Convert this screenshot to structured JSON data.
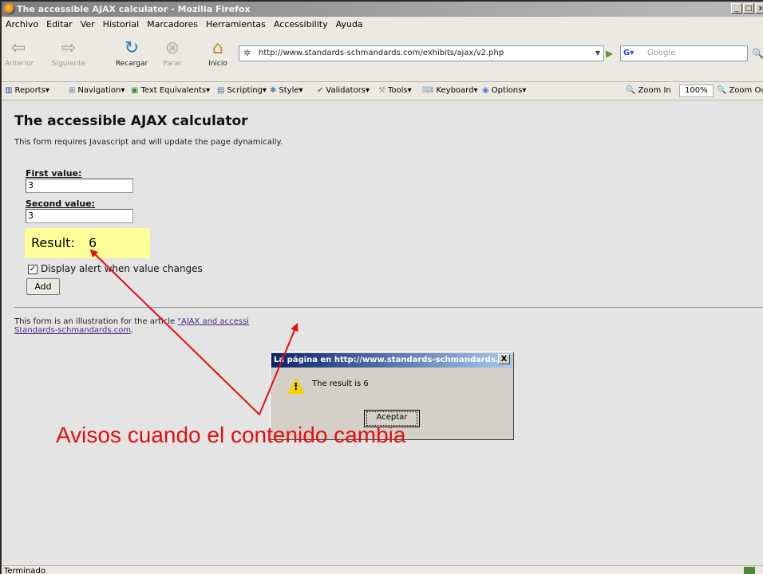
{
  "window": {
    "title": "The accessible AJAX calculator - Mozilla Firefox",
    "buttons": [
      "_",
      "□",
      "x"
    ]
  },
  "menu": [
    "Archivo",
    "Editar",
    "Ver",
    "Historial",
    "Marcadores",
    "Herramientas",
    "Accessibility",
    "Ayuda"
  ],
  "nav": {
    "back": "Anterior",
    "forward": "Siguiente",
    "reload": "Recargar",
    "stop": "Parar",
    "home": "Inicio",
    "url": "http://www.standards-schmandards.com/exhibits/ajax/v2.php",
    "search_placeholder": "Google"
  },
  "devtoolbar": {
    "items": [
      "Reports",
      "Navigation",
      "Text Equivalents",
      "Scripting",
      "Style",
      "Validators",
      "Tools",
      "Keyboard",
      "Options"
    ],
    "zoom_in": "Zoom In",
    "zoom_value": "100%",
    "zoom_out": "Zoom Ou"
  },
  "page": {
    "title": "The accessible AJAX calculator",
    "description": "This form requires Javascript and will update the page dynamically.",
    "first_label": "First value:",
    "first_value": "3",
    "second_label": "Second value:",
    "second_value": "3",
    "result_label": "Result:",
    "result_value": "6",
    "checkbox_label": "Display alert when value changes",
    "checkbox_checked": true,
    "add_button": "Add",
    "footer_prefix": "This form is an illustration for the article ",
    "footer_link": "\"AJAX and accessi",
    "footer_site": "Standards-schmandards.com",
    "footer_suffix": "."
  },
  "dialog": {
    "title": "La página en http://www.standards-schmandards....",
    "close": "X",
    "message": "The result is 6",
    "ok_button": "Aceptar"
  },
  "status": {
    "text": "Terminado"
  },
  "annotation": {
    "text": "Avisos cuando el contenido cambia",
    "color": "#e01010"
  }
}
